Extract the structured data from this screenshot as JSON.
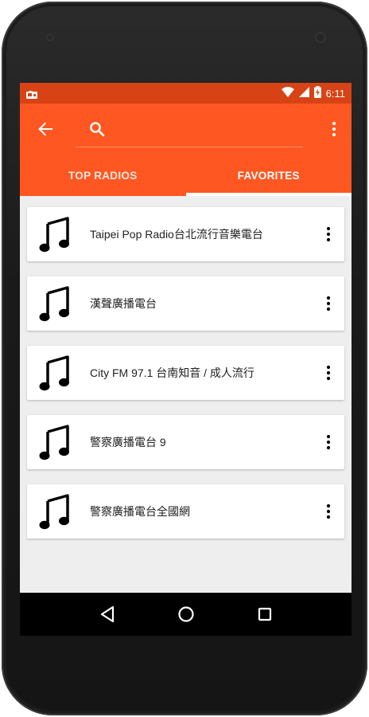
{
  "status_bar": {
    "time": "6:11",
    "icons": [
      "radio-icon",
      "wifi-icon",
      "signal-icon",
      "battery-charging-icon"
    ]
  },
  "toolbar": {
    "back_icon": "arrow-back-icon",
    "search_icon": "search-icon",
    "search_placeholder": "",
    "overflow_icon": "more-vert-icon"
  },
  "tabs": [
    {
      "label": "TOP RADIOS",
      "active": false
    },
    {
      "label": "FAVORITES",
      "active": true
    }
  ],
  "stations": [
    {
      "name": "Taipei Pop Radio台北流行音樂電台",
      "icon": "music-note-icon"
    },
    {
      "name": "漢聲廣播電台",
      "icon": "music-note-icon"
    },
    {
      "name": "City FM 97.1 台南知音 / 成人流行",
      "icon": "music-note-icon"
    },
    {
      "name": "警察廣播電台 9",
      "icon": "music-note-icon"
    },
    {
      "name": "警察廣播電台全國網",
      "icon": "music-note-icon"
    }
  ],
  "nav": [
    "back-icon",
    "home-icon",
    "recents-icon"
  ],
  "colors": {
    "accent": "#ff5722",
    "status_bar": "#d84315",
    "background": "#eeeeee"
  }
}
